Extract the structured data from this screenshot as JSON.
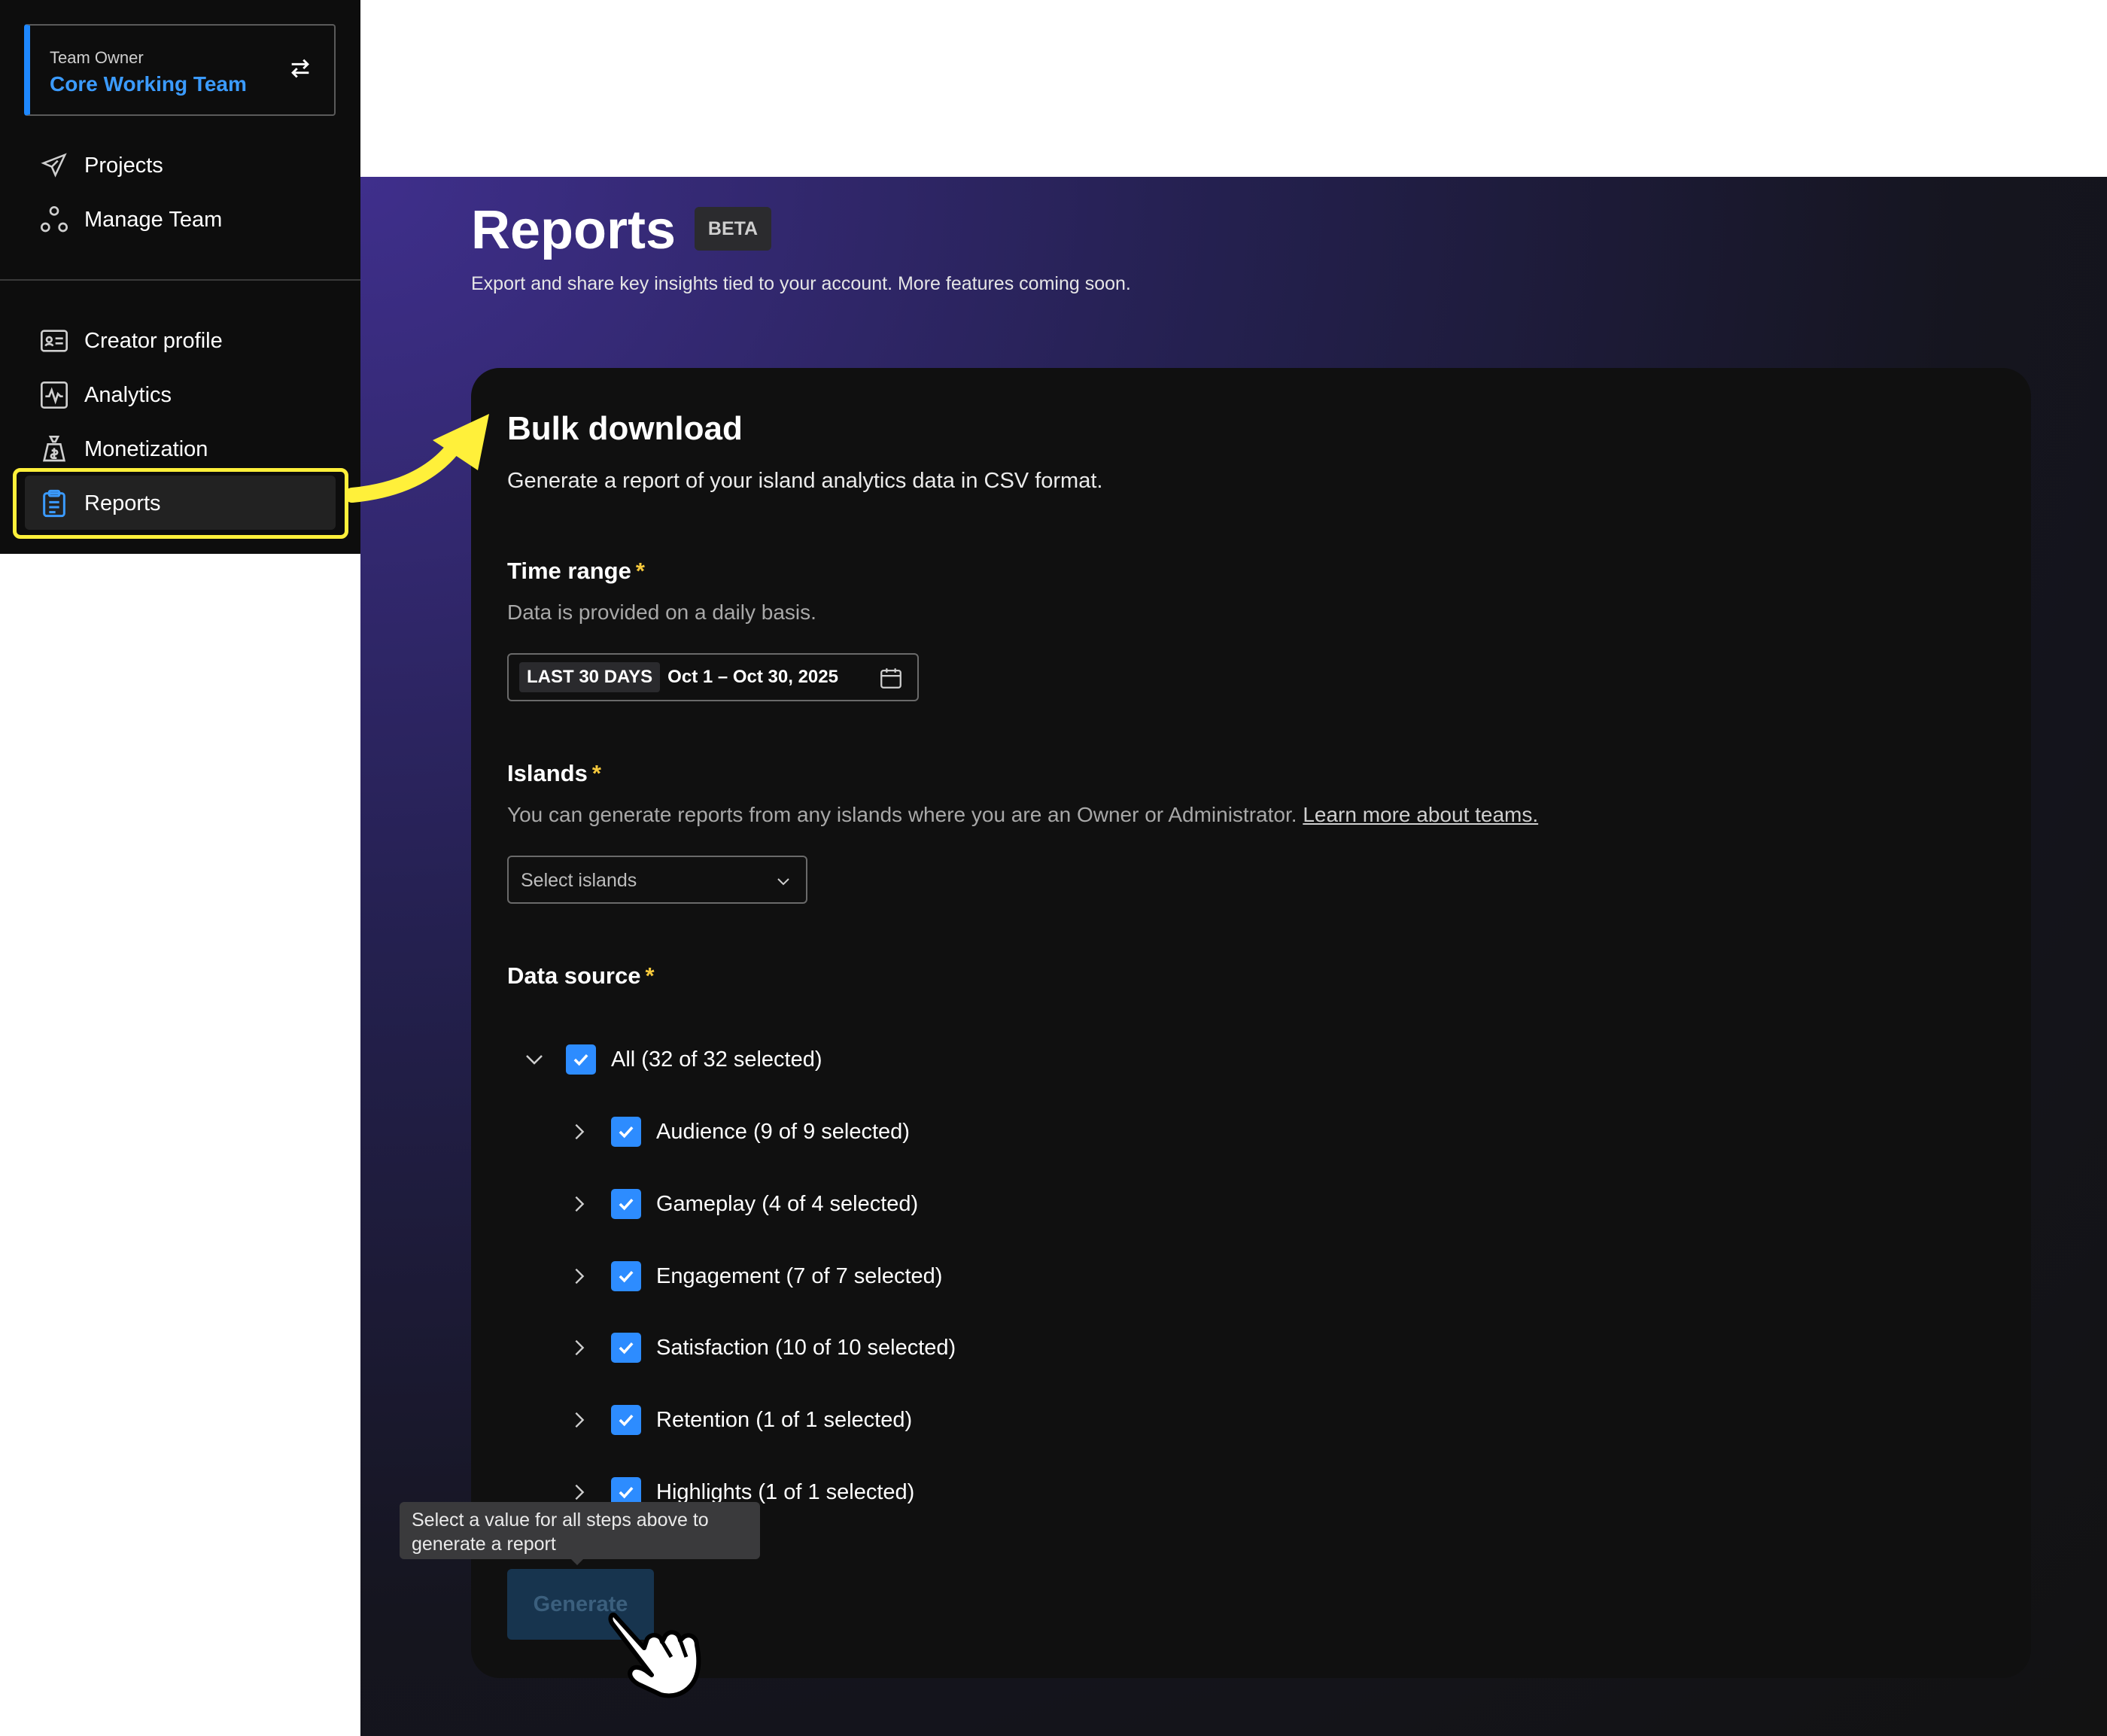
{
  "sidebar": {
    "team_role": "Team Owner",
    "team_name": "Core Working Team",
    "nav_top": [
      {
        "label": "Projects",
        "icon": "send-icon"
      },
      {
        "label": "Manage Team",
        "icon": "team-icon"
      }
    ],
    "nav_bottom": [
      {
        "label": "Creator profile",
        "icon": "profile-card-icon"
      },
      {
        "label": "Analytics",
        "icon": "analytics-icon"
      },
      {
        "label": "Monetization",
        "icon": "money-bag-icon"
      },
      {
        "label": "Reports",
        "icon": "clipboard-icon",
        "active": true
      }
    ]
  },
  "header": {
    "title": "Reports",
    "badge": "BETA",
    "subtitle": "Export and share key insights tied to your account. More features coming soon."
  },
  "card": {
    "title": "Bulk download",
    "subtitle": "Generate a report of your island analytics data in CSV format.",
    "time_range": {
      "label": "Time range",
      "required": "*",
      "help": "Data is provided on a daily basis.",
      "chip": "LAST 30 DAYS",
      "dates": "Oct 1 – Oct 30, 2025"
    },
    "islands": {
      "label": "Islands",
      "required": "*",
      "help": "You can generate reports from any islands where you are an Owner or Administrator.",
      "link": "Learn more about teams.",
      "placeholder": "Select islands"
    },
    "data_source": {
      "label": "Data source",
      "required": "*",
      "all": "All (32 of 32 selected)",
      "items": [
        "Audience (9 of 9 selected)",
        "Gameplay (4 of 4 selected)",
        "Engagement (7 of 7 selected)",
        "Satisfaction (10 of 10 selected)",
        "Retention (1 of 1 selected)",
        "Highlights (1 of 1 selected)"
      ]
    },
    "tooltip": "Select a value for all steps above to generate a report",
    "generate_label": "Generate"
  },
  "colors": {
    "accent": "#2d8cff",
    "highlight": "#fff03a",
    "required": "#f5c83c"
  }
}
